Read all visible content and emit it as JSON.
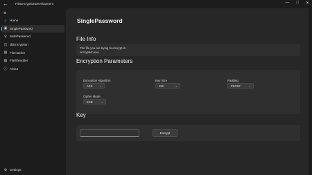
{
  "window": {
    "title": "FileEncryptionDevelopment",
    "back_icon": "back-arrow-icon",
    "controls": [
      "minimize-icon",
      "maximize-icon",
      "close-icon"
    ]
  },
  "sidebar": {
    "items": [
      {
        "label": "Home",
        "icon": "home-icon"
      },
      {
        "label": "SinglePassword",
        "icon": "lock-icon",
        "active": true
      },
      {
        "label": "MultiPassword",
        "icon": "key-icon"
      },
      {
        "label": "dbEncryption",
        "icon": "database-icon"
      },
      {
        "label": "FileHasher",
        "icon": "file-icon"
      },
      {
        "label": "FileShredder",
        "icon": "folder-icon"
      },
      {
        "label": "About",
        "icon": "info-icon"
      }
    ],
    "settings_label": "Settings"
  },
  "page": {
    "title": "SinglePassword",
    "file_info": {
      "heading": "File Info",
      "line1": "The file you are trying to encrypt is:",
      "filename": "encryption.exe"
    },
    "params": {
      "heading": "Encryption Parameters",
      "algorithm": {
        "label": "Encryption Algorithm",
        "value": "AES"
      },
      "key_size": {
        "label": "Key Size",
        "value": "192"
      },
      "padding": {
        "label": "Padding",
        "value": "PKCS7"
      },
      "cipher_mode": {
        "label": "Cipher Mode",
        "value": "ECB"
      }
    },
    "key": {
      "heading": "Key",
      "input_value": "",
      "encrypt_label": "Encrypt"
    }
  },
  "colors": {
    "accent": "#76b9ed",
    "background": "#1c1c1c",
    "content": "#272727",
    "card": "#2f2f2f"
  }
}
